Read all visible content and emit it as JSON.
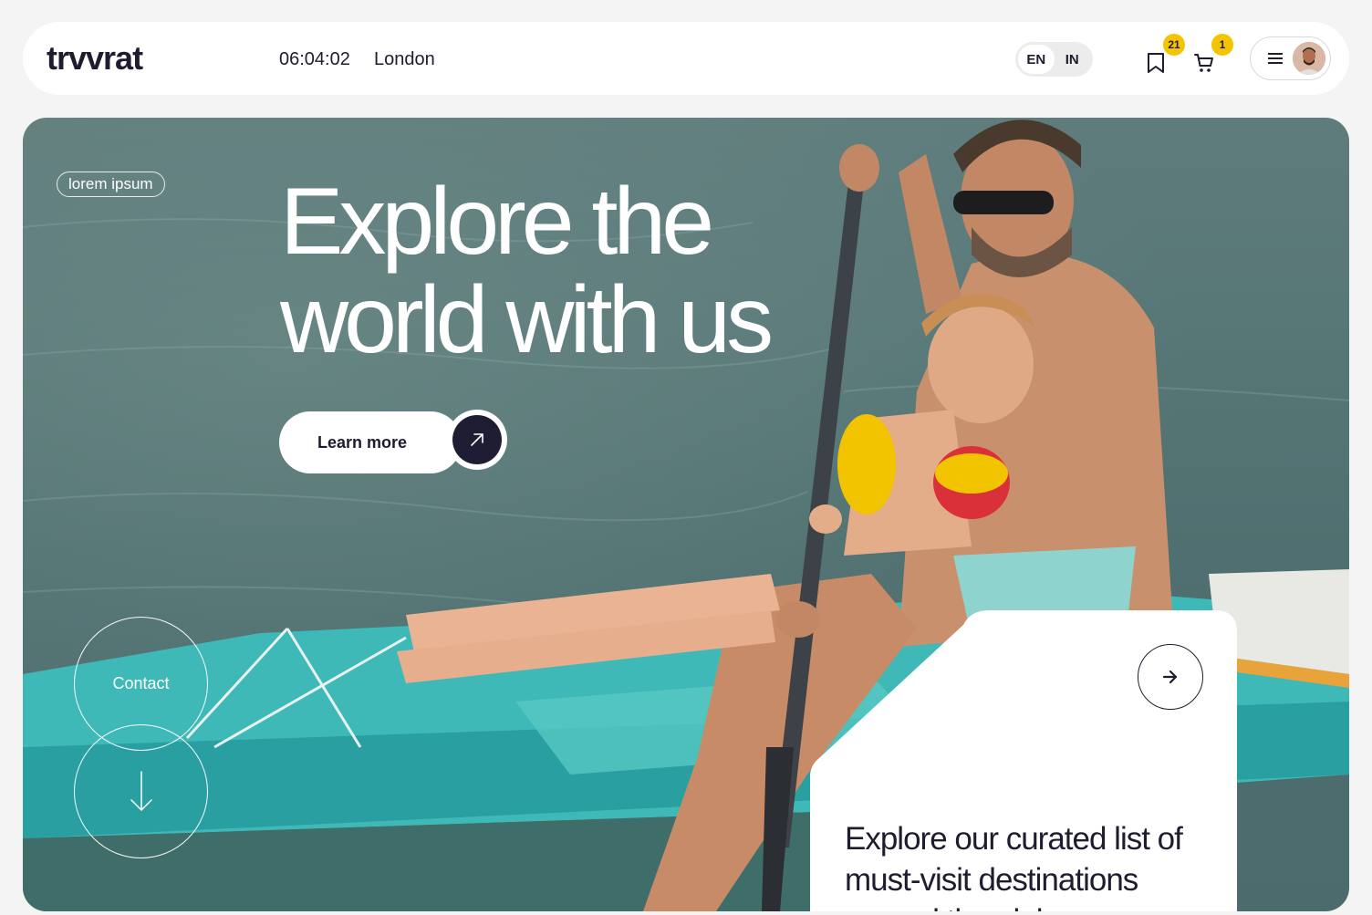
{
  "header": {
    "logo": "trvvrat",
    "time": "06:04:02",
    "city": "London",
    "languages": [
      {
        "code": "EN",
        "active": true
      },
      {
        "code": "IN",
        "active": false
      }
    ],
    "saved_count": "21",
    "cart_count": "1",
    "icons": {
      "saved": "bookmark-icon",
      "cart": "cart-icon",
      "menu": "menu-icon"
    },
    "badge_color": "#f5c400"
  },
  "hero": {
    "tag": "lorem ipsum",
    "headline": "Explore the world with us",
    "cta_label": "Learn more",
    "contact_label": "Contact",
    "card_text": "Explore our curated list of must-visit destinations around the globe"
  },
  "colors": {
    "dark": "#1e1c2e",
    "accent_badge": "#f5c400",
    "background": "#f4f4f4"
  }
}
